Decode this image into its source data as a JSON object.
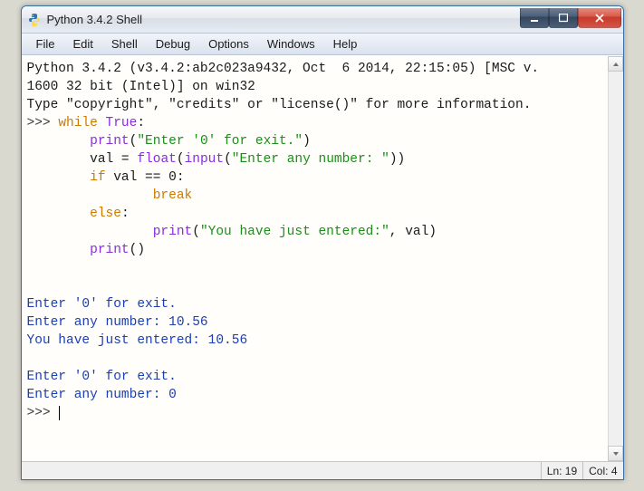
{
  "window": {
    "title": "Python 3.4.2 Shell"
  },
  "menu": {
    "file": "File",
    "edit": "Edit",
    "shell": "Shell",
    "debug": "Debug",
    "options": "Options",
    "windows": "Windows",
    "help": "Help"
  },
  "banner": {
    "line1": "Python 3.4.2 (v3.4.2:ab2c023a9432, Oct  6 2014, 22:15:05) [MSC v.",
    "line2": "1600 32 bit (Intel)] on win32",
    "line3": "Type \"copyright\", \"credits\" or \"license()\" for more information."
  },
  "code": {
    "prompt": ">>>",
    "kw_while": "while",
    "true_lit": "True",
    "colon": ":",
    "print": "print",
    "str_exit": "\"Enter '0' for exit.\"",
    "assign": "val = ",
    "float": "float",
    "input": "input",
    "str_enter": "\"Enter any number: \"",
    "kw_if": "if",
    "cond": " val == 0:",
    "kw_break": "break",
    "kw_else": "else",
    "str_entered": "\"You have just entered:\"",
    "val_ref": ", val)",
    "print_empty_paren": "()"
  },
  "output": {
    "exit1": "Enter '0' for exit.",
    "enter1": "Enter any number: 10.56",
    "entered1": "You have just entered: 10.56",
    "exit2": "Enter '0' for exit.",
    "enter2": "Enter any number: 0"
  },
  "status": {
    "ln": "Ln: 19",
    "col": "Col: 4"
  }
}
